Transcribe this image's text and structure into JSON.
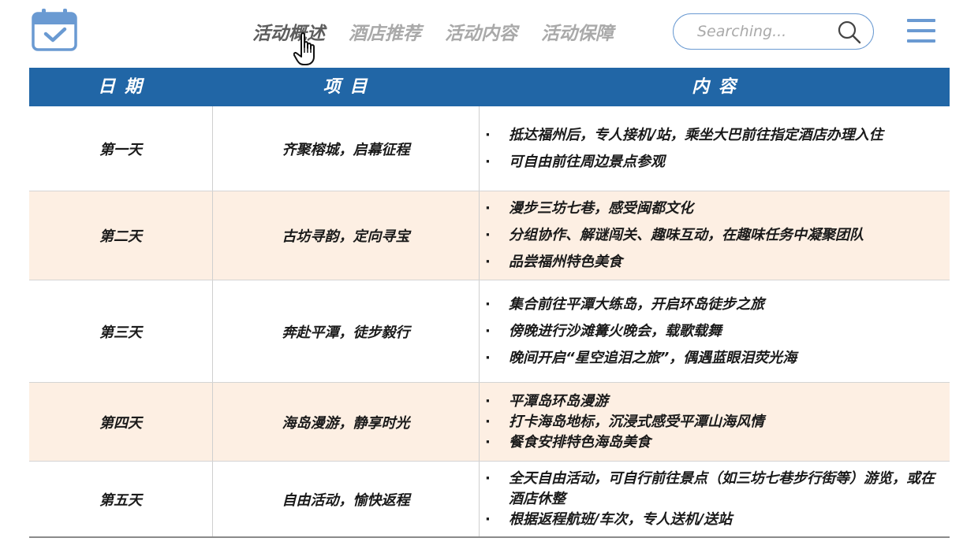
{
  "nav": {
    "items": [
      "活动概述",
      "酒店推荐",
      "活动内容",
      "活动保障"
    ],
    "active_index": 0
  },
  "search": {
    "placeholder": "Searching..."
  },
  "table": {
    "headers": [
      "日 期",
      "项 目",
      "内 容"
    ],
    "rows": [
      {
        "day": "第一天",
        "item": "齐聚榕城，启幕征程",
        "content": [
          "抵达福州后，专人接机/站，乘坐大巴前往指定酒店办理入住",
          "可自由前往周边景点参观"
        ]
      },
      {
        "day": "第二天",
        "item": "古坊寻韵，定向寻宝",
        "content": [
          "漫步三坊七巷，感受闽都文化",
          "分组协作、解谜闯关、趣味互动，在趣味任务中凝聚团队",
          "品尝福州特色美食"
        ]
      },
      {
        "day": "第三天",
        "item": "奔赴平潭，徒步毅行",
        "content": [
          "集合前往平潭大练岛，开启环岛徒步之旅",
          "傍晚进行沙滩篝火晚会，载歌载舞",
          "晚间开启“星空追泪之旅”，偶遇蓝眼泪荧光海"
        ]
      },
      {
        "day": "第四天",
        "item": "海岛漫游，静享时光",
        "content": [
          "平潭岛环岛漫游",
          "打卡海岛地标，沉浸式感受平潭山海风情",
          "餐食安排特色海岛美食"
        ]
      },
      {
        "day": "第五天",
        "item": "自由活动，愉快返程",
        "content": [
          "全天自由活动，可自行前往景点（如三坊七巷步行街等）游览，或在酒店休整",
          "根据返程航班/车次，专人送机/送站"
        ]
      }
    ]
  },
  "colors": {
    "accent": "#6a9ad2",
    "header_bg": "#2166a6",
    "row_shade": "#fdefe3"
  }
}
